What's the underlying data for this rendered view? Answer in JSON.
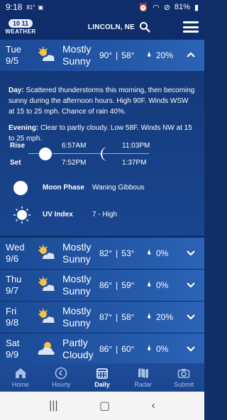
{
  "status": {
    "time": "9:18",
    "temp_small": "81°",
    "battery": "81%"
  },
  "header": {
    "logo_badge": "10 11",
    "logo_word": "WEATHER",
    "location": "LINCOLN, NE"
  },
  "today": {
    "day": "Tue",
    "date": "9/5",
    "condition_line1": "Mostly",
    "condition_line2": "Sunny",
    "high": "90°",
    "low": "58°",
    "precip": "20%",
    "day_label": "Day:",
    "day_text": "Scattered thunderstorms this morning, then becoming sunny during the afternoon hours. High 90F. Winds WSW at 15 to 25 mph. Chance of rain 40%.",
    "evening_label": "Evening:",
    "evening_text": "Clear to partly cloudy. Low 58F. Winds NW at 15 to 25 mph.",
    "rise_label": "Rise",
    "set_label": "Set",
    "sunrise": "6:57AM",
    "sunset": "7:52PM",
    "moonrise": "11:03PM",
    "moonset": "1:37PM",
    "moon_phase_label": "Moon Phase",
    "moon_phase": "Waning Gibbous",
    "uv_label": "UV Index",
    "uv_value": "7 - High"
  },
  "days": [
    {
      "day": "Wed",
      "date": "9/6",
      "condition_line1": "Mostly",
      "condition_line2": "Sunny",
      "high": "82°",
      "low": "53°",
      "precip": "0%",
      "icon": "partly-sunny-icon"
    },
    {
      "day": "Thu",
      "date": "9/7",
      "condition_line1": "Mostly",
      "condition_line2": "Sunny",
      "high": "86°",
      "low": "59°",
      "precip": "0%",
      "icon": "partly-sunny-icon"
    },
    {
      "day": "Fri",
      "date": "9/8",
      "condition_line1": "Mostly",
      "condition_line2": "Sunny",
      "high": "87°",
      "low": "58°",
      "precip": "20%",
      "icon": "partly-sunny-icon"
    },
    {
      "day": "Sat",
      "date": "9/9",
      "condition_line1": "Partly",
      "condition_line2": "Cloudy",
      "high": "86°",
      "low": "60°",
      "precip": "0%",
      "icon": "partly-cloudy-icon"
    }
  ],
  "nav": [
    {
      "label": "Home"
    },
    {
      "label": "Hourly"
    },
    {
      "label": "Daily"
    },
    {
      "label": "Radar"
    },
    {
      "label": "Submit"
    }
  ],
  "colors": {
    "accent": "#2458a8",
    "background": "#0f2f66",
    "sun": "#f6c343"
  }
}
